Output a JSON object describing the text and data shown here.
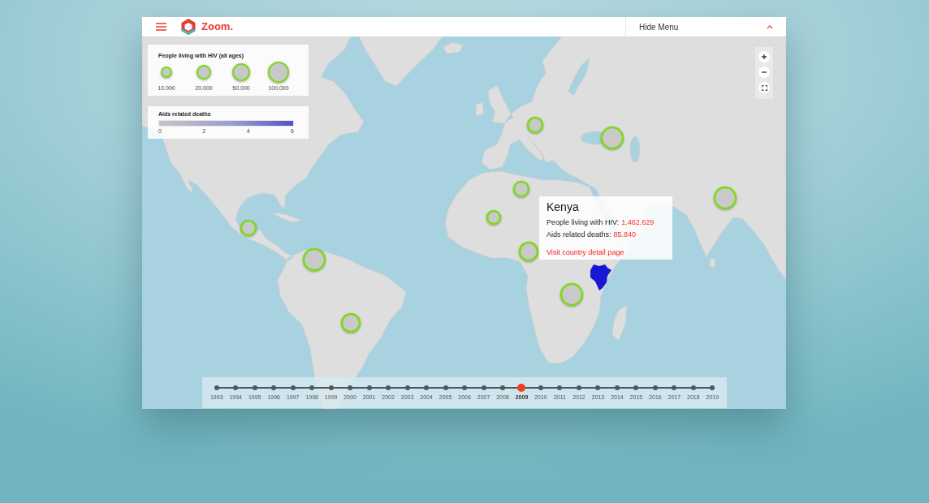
{
  "header": {
    "logo_text": "Zoom.",
    "menu_toggle": {
      "label": "Hide Menu",
      "expanded": true
    }
  },
  "legends": [
    {
      "kind": "size",
      "title": "People living with HIV (all ages)",
      "items": [
        "10.000",
        "20.000",
        "50.000",
        "100.000"
      ]
    },
    {
      "kind": "gradient",
      "title": "Aids related deaths",
      "ticks": [
        "0",
        "2",
        "4",
        "6"
      ]
    }
  ],
  "tooltip": {
    "title": "Kenya",
    "rows": [
      {
        "label": "People living with HIV:",
        "value": "1.462.629"
      },
      {
        "label": "Aids related deaths:",
        "value": "85.840"
      }
    ],
    "link": "Visit country detail page"
  },
  "timeline": {
    "years": [
      {
        "label": "1993",
        "selected": false
      },
      {
        "label": "1994",
        "selected": false
      },
      {
        "label": "1995",
        "selected": false
      },
      {
        "label": "1996",
        "selected": false
      },
      {
        "label": "1997",
        "selected": false
      },
      {
        "label": "1998",
        "selected": false
      },
      {
        "label": "1999",
        "selected": false
      },
      {
        "label": "2000",
        "selected": false
      },
      {
        "label": "2001",
        "selected": false
      },
      {
        "label": "2002",
        "selected": false
      },
      {
        "label": "2003",
        "selected": false
      },
      {
        "label": "2004",
        "selected": false
      },
      {
        "label": "2005",
        "selected": false
      },
      {
        "label": "2006",
        "selected": false
      },
      {
        "label": "2007",
        "selected": false
      },
      {
        "label": "2008",
        "selected": false
      },
      {
        "label": "2009",
        "selected": true
      },
      {
        "label": "2010",
        "selected": false
      },
      {
        "label": "2011",
        "selected": false
      },
      {
        "label": "2012",
        "selected": false
      },
      {
        "label": "2013",
        "selected": false
      },
      {
        "label": "2014",
        "selected": false
      },
      {
        "label": "2015",
        "selected": false
      },
      {
        "label": "2016",
        "selected": false
      },
      {
        "label": "2017",
        "selected": false
      },
      {
        "label": "2018",
        "selected": false
      },
      {
        "label": "2019",
        "selected": false
      }
    ]
  }
}
